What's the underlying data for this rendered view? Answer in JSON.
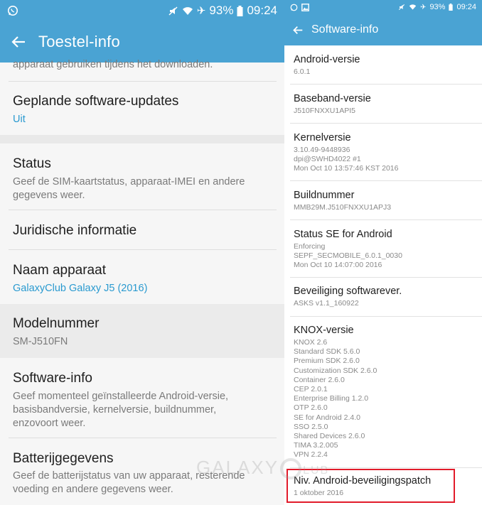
{
  "left": {
    "statusbar": {
      "battery": "93%",
      "time": "09:24"
    },
    "title": "Toestel-info",
    "cutoff_text": "apparaat gebruiken tijdens het downloaden.",
    "items": [
      {
        "title": "Geplande software-updates",
        "subtitle": "Uit"
      },
      {
        "title": "Status",
        "subtitle": "Geef de SIM-kaartstatus, apparaat-IMEI en andere\ngegevens weer."
      },
      {
        "title": "Juridische informatie"
      },
      {
        "title": "Naam apparaat",
        "subtitle": "GalaxyClub Galaxy J5 (2016)"
      },
      {
        "title": "Modelnummer",
        "subtitle": "SM-J510FN"
      },
      {
        "title": "Software-info",
        "subtitle": "Geef momenteel geïnstalleerde Android-versie,\nbasisbandversie, kernelversie, buildnummer,\nenzovoort weer."
      },
      {
        "title": "Batterijgegevens",
        "subtitle": "Geef de batterijstatus van uw apparaat, resterende\nvoeding en andere gegevens weer."
      }
    ]
  },
  "right": {
    "statusbar": {
      "battery": "93%",
      "time": "09:24"
    },
    "title": "Software-info",
    "items": [
      {
        "title": "Android-versie",
        "subtitle": "6.0.1"
      },
      {
        "title": "Baseband-versie",
        "subtitle": "J510FNXXU1API5"
      },
      {
        "title": "Kernelversie",
        "subtitle": "3.10.49-9448936\ndpi@SWHD4022 #1\nMon Oct 10 13:57:46 KST 2016"
      },
      {
        "title": "Buildnummer",
        "subtitle": "MMB29M.J510FNXXU1APJ3"
      },
      {
        "title": "Status SE for Android",
        "subtitle": "Enforcing\nSEPF_SECMOBILE_6.0.1_0030\nMon Oct 10 14:07:00 2016"
      },
      {
        "title": "Beveiliging softwarever.",
        "subtitle": "ASKS v1.1_160922"
      },
      {
        "title": "KNOX-versie",
        "subtitle": "KNOX 2.6\nStandard SDK 5.6.0\nPremium SDK 2.6.0\nCustomization SDK 2.6.0\nContainer 2.6.0\nCEP 2.0.1\nEnterprise Billing 1.2.0\nOTP 2.6.0\nSE for Android 2.4.0\nSSO 2.5.0\nShared Devices 2.6.0\nTIMA 3.2.005\nVPN 2.2.4"
      },
      {
        "title": "Niv. Android-beveiligingspatch",
        "subtitle": "1 oktober 2016"
      }
    ]
  },
  "watermark": {
    "prefix": "GALAXY",
    "suffix": "LUB"
  },
  "icons": [
    "whatsapp-icon",
    "gallery-icon",
    "mute-icon",
    "wifi-icon",
    "airplane-icon",
    "battery-icon",
    "back-arrow-icon"
  ],
  "colors": {
    "appbar": "#4aa3d3",
    "accent_text": "#2a9ad0",
    "highlight_box": "#e21b2a"
  }
}
